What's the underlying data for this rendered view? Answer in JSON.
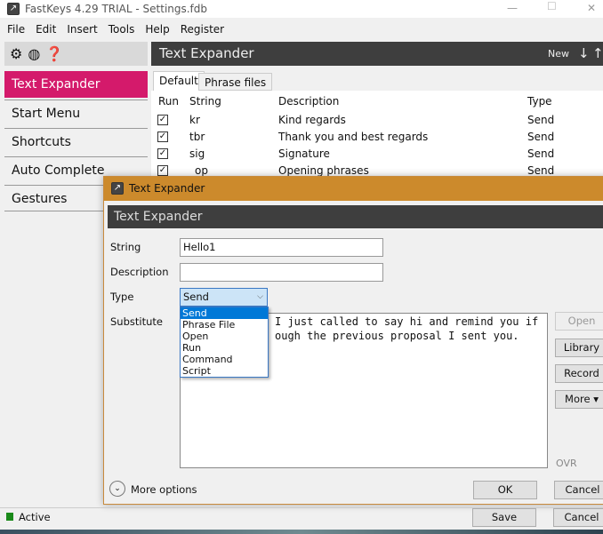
{
  "window": {
    "title": "FastKeys 4.29 TRIAL - Settings.fdb",
    "minimize": "—",
    "maximize": "☐",
    "close": "✕"
  },
  "menu": [
    "File",
    "Edit",
    "Insert",
    "Tools",
    "Help",
    "Register"
  ],
  "toolbar_icons": [
    "gear-icon",
    "globe-icon",
    "help-icon"
  ],
  "header": {
    "title": "Text Expander",
    "new_label": "New",
    "down": "↓",
    "up": "↑"
  },
  "sidebar": [
    "Text Expander",
    "Start Menu",
    "Shortcuts",
    "Auto Complete",
    "Gestures"
  ],
  "tabs": [
    "Default",
    "Phrase files"
  ],
  "table": {
    "columns": [
      "Run",
      "String",
      "Description",
      "Type"
    ],
    "rows": [
      {
        "string": "kr",
        "description": "Kind regards",
        "type": "Send"
      },
      {
        "string": "tbr",
        "description": "Thank you and best regards",
        "type": "Send"
      },
      {
        "string": "sig",
        "description": "Signature",
        "type": "Send"
      },
      {
        "string": "_op",
        "description": "Opening phrases",
        "type": "Send"
      }
    ]
  },
  "dialog": {
    "title": "Text Expander",
    "header": "Text Expander",
    "string_label": "String",
    "string_value": "Hello1",
    "description_label": "Description",
    "description_value": "",
    "type_label": "Type",
    "type_value": "Send",
    "type_options": [
      "Send",
      "Phrase File",
      "Open",
      "Run",
      "Command",
      "Script"
    ],
    "substitute_label": "Substitute",
    "substitute_line1": "I just called to say hi and remind you if",
    "substitute_line2": "ough the previous proposal I sent you.",
    "buttons": {
      "open": "Open",
      "library": "Library",
      "record": "Record",
      "more": "More ▾",
      "ok": "OK",
      "cancel": "Cancel"
    },
    "ovr": "OVR",
    "more_options": "More options"
  },
  "status": {
    "text": "Active",
    "color": "#1a8a1a"
  },
  "footer": {
    "save": "Save",
    "cancel": "Cancel"
  }
}
